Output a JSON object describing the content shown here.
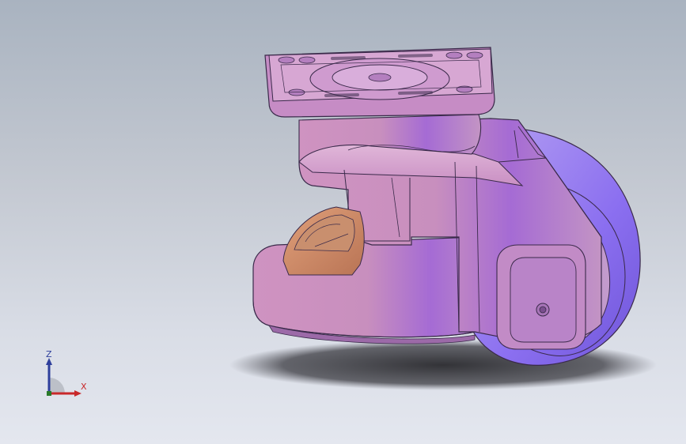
{
  "viewport": {
    "background_top": "#a9b3c0",
    "background_bottom": "#e4e7ef"
  },
  "model": {
    "colors": {
      "body": "#c88fbe",
      "body_light": "#d8a7cf",
      "body_dark": "#a068b8",
      "wheel": "#9a7ff0",
      "wheel_dark": "#7d63e0",
      "brake_pad": "#c88864",
      "outline": "#3a2a4a",
      "shadow": "#2f2f34"
    }
  },
  "triad": {
    "z_label": "Z",
    "x_label": "X",
    "z_color": "#2e3f9c",
    "x_color": "#c8282a",
    "icon": "axis-triad-icon"
  }
}
